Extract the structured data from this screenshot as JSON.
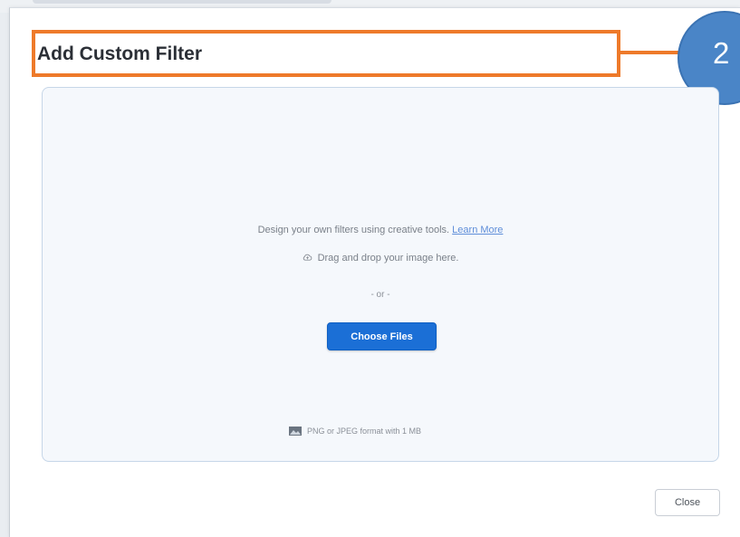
{
  "dialog": {
    "title": "Add Custom Filter",
    "annotation_number": "2",
    "annotation_color": "#ee7a2a",
    "badge_color": "#4a85c7"
  },
  "drop_zone": {
    "description": "Design your own filters using creative tools.",
    "learn_more_label": "Learn More",
    "drag_text": "Drag and drop your image here.",
    "or_text": "- or -",
    "choose_files_label": "Choose Files",
    "format_note": "PNG or JPEG format with 1 MB",
    "upload_icon": "upload-cloud-icon",
    "image_icon": "image-icon"
  },
  "footer": {
    "close_label": "Close"
  },
  "colors": {
    "primary_button": "#1b6fd6",
    "link": "#5f8ed9"
  }
}
